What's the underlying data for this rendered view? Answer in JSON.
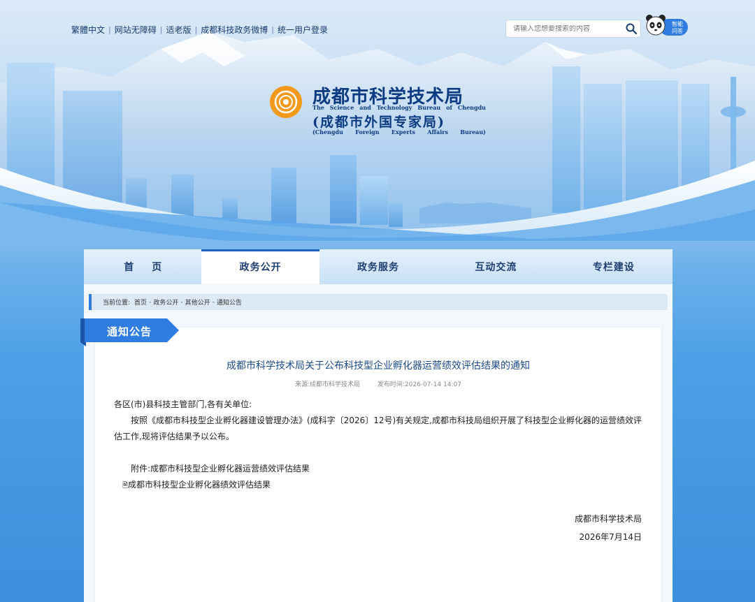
{
  "top_links": [
    "繁體中文",
    "网站无障碍",
    "适老版",
    "成都科技政务微博",
    "统一用户登录"
  ],
  "search": {
    "placeholder": "请输入您想要搜索的内容"
  },
  "assistant": {
    "line1": "智能",
    "line2": "问答"
  },
  "logo": {
    "title": "成都市科学技术局",
    "subtitle_en": [
      "The",
      "Science",
      "and",
      "Technology",
      "Bureau",
      "of",
      "Chengdu"
    ],
    "title2": "(成都市外国专家局)",
    "title2_en": [
      "(Chengdu",
      "Foreign",
      "Experts",
      "Affairs",
      "Bureau)"
    ]
  },
  "nav": [
    "首页",
    "政务公开",
    "政务服务",
    "互动交流",
    "专栏建设"
  ],
  "nav_active_index": 1,
  "breadcrumb": {
    "prefix": "当前位置:",
    "items": [
      "首页",
      "政务公开",
      "其他公开",
      "通知公告"
    ]
  },
  "section_tag": "通知公告",
  "article": {
    "title": "成都市科学技术局关于公布科技型企业孵化器运营绩效评估结果的通知",
    "source": "来源:成都市科学技术局",
    "published": "发布时间:2026-07-14 14:07",
    "salutation": "各区(市)县科技主管部门,各有关单位:",
    "paragraph": "按照《成都市科技型企业孵化器建设管理办法》(成科字〔2026〕12号)有关规定,成都市科技局组织开展了科技型企业孵化器的运营绩效评估工作,现将评估结果予以公布。",
    "attachment_label": "附件:成都市科技型企业孵化器运营绩效评估结果",
    "attachment_file": "成都市科技型企业孵化器绩效评估结果",
    "signature": "成都市科学技术局",
    "date": "2026年7月14日"
  },
  "colors": {
    "primary": "#2f7de0",
    "title_blue": "#1d4b88",
    "nav_text": "#1d3f72"
  }
}
